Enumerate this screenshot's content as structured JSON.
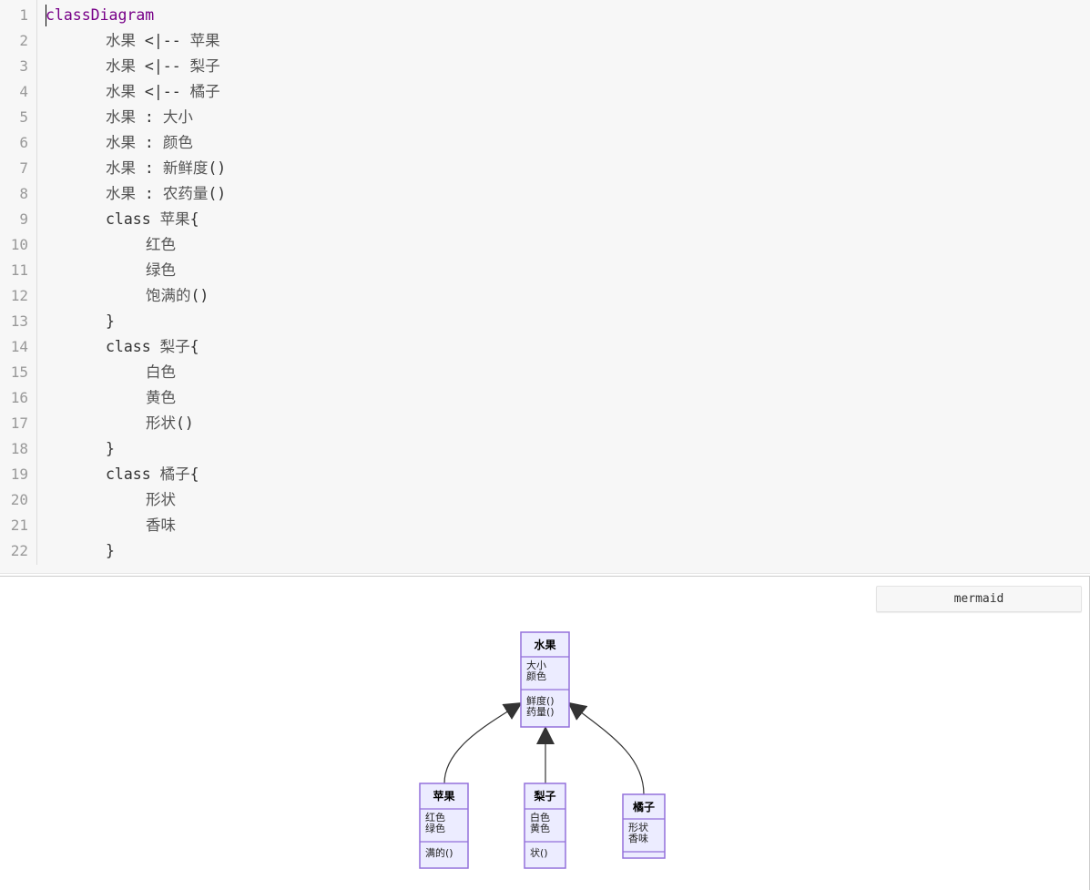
{
  "editor": {
    "lines": [
      {
        "num": "1",
        "indent": 0,
        "parts": [
          {
            "t": "classDiagram",
            "c": "kw-purple"
          }
        ]
      },
      {
        "num": "2",
        "indent": 1,
        "parts": [
          {
            "t": "水果",
            "c": "cjk"
          },
          {
            "t": " <|-- ",
            "c": ""
          },
          {
            "t": "苹果",
            "c": "cjk"
          }
        ]
      },
      {
        "num": "3",
        "indent": 1,
        "parts": [
          {
            "t": "水果",
            "c": "cjk"
          },
          {
            "t": " <|-- ",
            "c": ""
          },
          {
            "t": "梨子",
            "c": "cjk"
          }
        ]
      },
      {
        "num": "4",
        "indent": 1,
        "parts": [
          {
            "t": "水果",
            "c": "cjk"
          },
          {
            "t": " <|-- ",
            "c": ""
          },
          {
            "t": "橘子",
            "c": "cjk"
          }
        ]
      },
      {
        "num": "5",
        "indent": 1,
        "parts": [
          {
            "t": "水果",
            "c": "cjk"
          },
          {
            "t": " : ",
            "c": ""
          },
          {
            "t": "大小",
            "c": "cjk"
          }
        ]
      },
      {
        "num": "6",
        "indent": 1,
        "parts": [
          {
            "t": "水果",
            "c": "cjk"
          },
          {
            "t": " : ",
            "c": ""
          },
          {
            "t": "颜色",
            "c": "cjk"
          }
        ]
      },
      {
        "num": "7",
        "indent": 1,
        "parts": [
          {
            "t": "水果",
            "c": "cjk"
          },
          {
            "t": " : ",
            "c": ""
          },
          {
            "t": "新鲜度",
            "c": "cjk"
          },
          {
            "t": "()",
            "c": ""
          }
        ]
      },
      {
        "num": "8",
        "indent": 1,
        "parts": [
          {
            "t": "水果",
            "c": "cjk"
          },
          {
            "t": " : ",
            "c": ""
          },
          {
            "t": "农药量",
            "c": "cjk"
          },
          {
            "t": "()",
            "c": ""
          }
        ]
      },
      {
        "num": "9",
        "indent": 1,
        "parts": [
          {
            "t": "class ",
            "c": ""
          },
          {
            "t": "苹果",
            "c": "cjk"
          },
          {
            "t": "{",
            "c": ""
          }
        ]
      },
      {
        "num": "10",
        "indent": 2,
        "parts": [
          {
            "t": "红色",
            "c": "cjk"
          }
        ]
      },
      {
        "num": "11",
        "indent": 2,
        "parts": [
          {
            "t": "绿色",
            "c": "cjk"
          }
        ]
      },
      {
        "num": "12",
        "indent": 2,
        "parts": [
          {
            "t": "饱满的",
            "c": "cjk"
          },
          {
            "t": "()",
            "c": ""
          }
        ]
      },
      {
        "num": "13",
        "indent": 1,
        "parts": [
          {
            "t": "}",
            "c": ""
          }
        ]
      },
      {
        "num": "14",
        "indent": 1,
        "parts": [
          {
            "t": "class ",
            "c": ""
          },
          {
            "t": "梨子",
            "c": "cjk"
          },
          {
            "t": "{",
            "c": ""
          }
        ]
      },
      {
        "num": "15",
        "indent": 2,
        "parts": [
          {
            "t": "白色",
            "c": "cjk"
          }
        ]
      },
      {
        "num": "16",
        "indent": 2,
        "parts": [
          {
            "t": "黄色",
            "c": "cjk"
          }
        ]
      },
      {
        "num": "17",
        "indent": 2,
        "parts": [
          {
            "t": "形状",
            "c": "cjk"
          },
          {
            "t": "()",
            "c": ""
          }
        ]
      },
      {
        "num": "18",
        "indent": 1,
        "parts": [
          {
            "t": "}",
            "c": ""
          }
        ]
      },
      {
        "num": "19",
        "indent": 1,
        "parts": [
          {
            "t": "class ",
            "c": ""
          },
          {
            "t": "橘子",
            "c": "cjk"
          },
          {
            "t": "{",
            "c": ""
          }
        ]
      },
      {
        "num": "20",
        "indent": 2,
        "parts": [
          {
            "t": "形状",
            "c": "cjk"
          }
        ]
      },
      {
        "num": "21",
        "indent": 2,
        "parts": [
          {
            "t": "香味",
            "c": "cjk"
          }
        ]
      },
      {
        "num": "22",
        "indent": 1,
        "parts": [
          {
            "t": "}",
            "c": ""
          }
        ]
      }
    ]
  },
  "preview": {
    "language_badge": "mermaid",
    "diagram": {
      "colors": {
        "fill": "#ECECFF",
        "stroke": "#9370DB",
        "edge": "#333333"
      },
      "classes": {
        "fruit": {
          "name": "水果",
          "attrs": [
            "大小",
            "颜色"
          ],
          "methods": [
            "鲜度()",
            "药量()"
          ]
        },
        "apple": {
          "name": "苹果",
          "attrs": [
            "红色",
            "绿色"
          ],
          "methods": [
            "满的()"
          ]
        },
        "pear": {
          "name": "梨子",
          "attrs": [
            "白色",
            "黄色"
          ],
          "methods": [
            "状()"
          ]
        },
        "orange": {
          "name": "橘子",
          "attrs": [
            "形状",
            "香味"
          ],
          "methods": []
        }
      }
    }
  }
}
